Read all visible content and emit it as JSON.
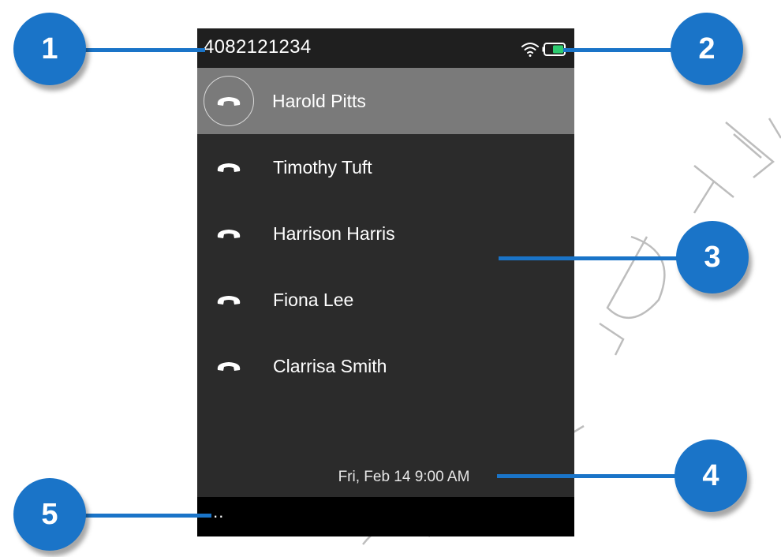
{
  "status_bar": {
    "number": "4082121234",
    "wifi_icon": "wifi-icon",
    "battery_icon": "battery-icon",
    "battery_color": "#2ecc71"
  },
  "calls": [
    {
      "name": "Harold Pitts",
      "icon": "phone-hangup-icon",
      "selected": true
    },
    {
      "name": "Timothy Tuft",
      "icon": "phone-hangup-icon",
      "selected": false
    },
    {
      "name": "Harrison Harris",
      "icon": "phone-hangup-icon",
      "selected": false
    },
    {
      "name": "Fiona Lee",
      "icon": "phone-hangup-icon",
      "selected": false
    },
    {
      "name": "Clarrisa Smith",
      "icon": "phone-hangup-icon",
      "selected": false
    }
  ],
  "datetime": "Fri, Feb 14  9:00 AM",
  "softkey": {
    "more_label": "..."
  },
  "callouts": [
    "1",
    "2",
    "3",
    "4",
    "5"
  ],
  "watermark_text": "CONFIDENTIAL DRAFT",
  "colors": {
    "callout": "#1a74c8",
    "screen_bg": "#2b2b2b",
    "selected_row": "#7a7a7a",
    "softkey_bg": "#000000"
  }
}
